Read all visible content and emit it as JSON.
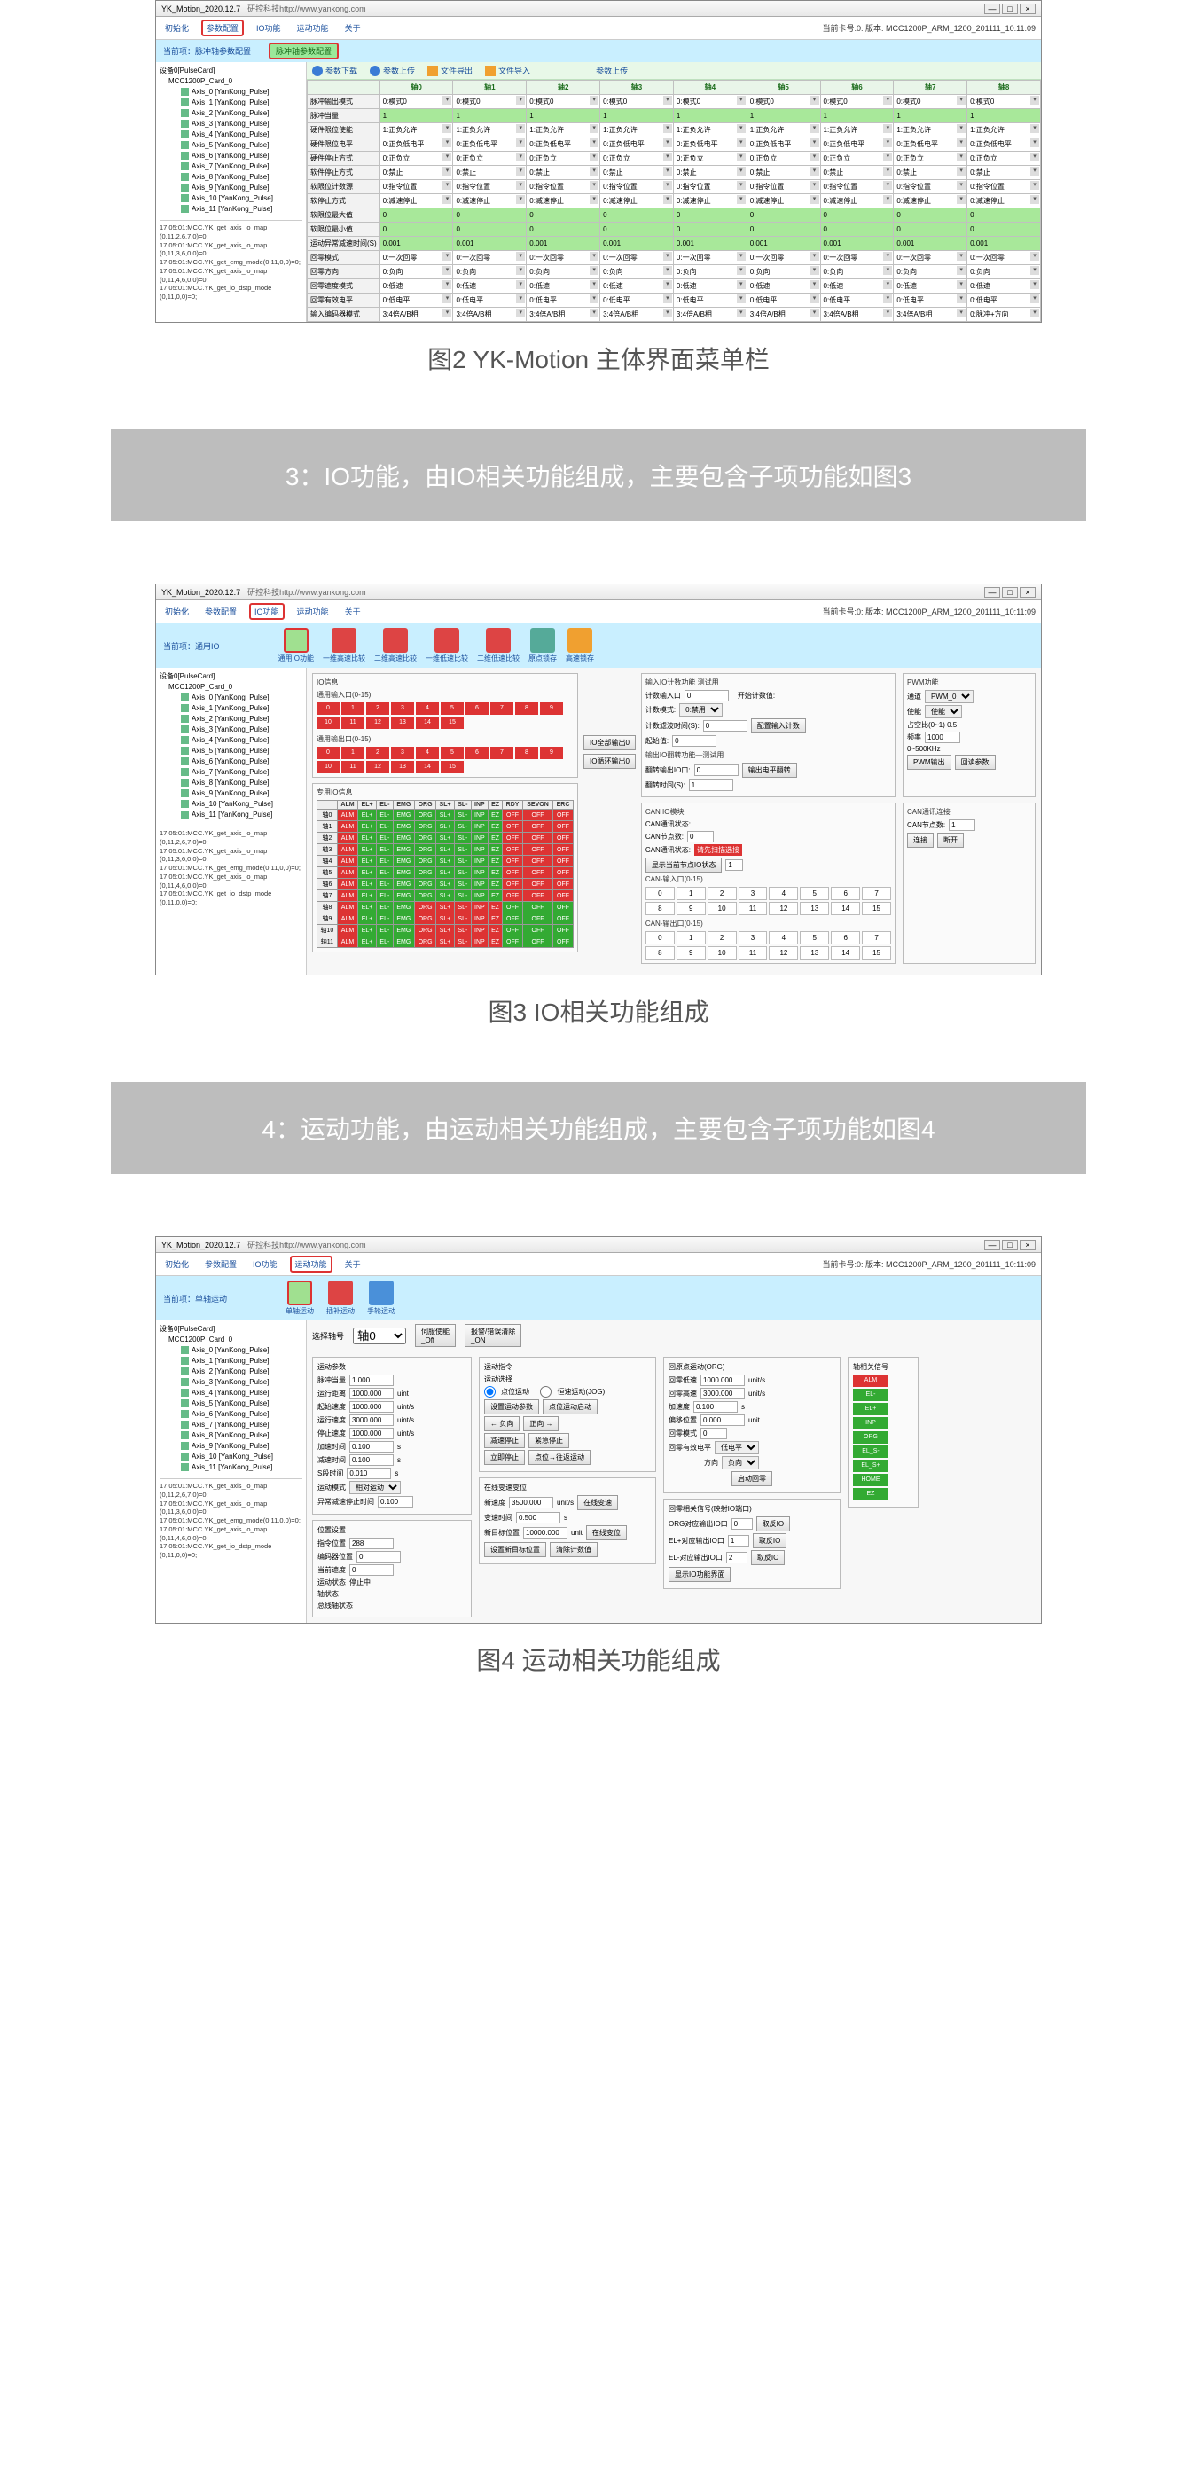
{
  "app_title": "YK_Motion_2020.12.7",
  "brand_text": "研控科技http://www.yankong.com",
  "card_info": "当前卡号:0: 版本: MCC1200P_ARM_1200_201111_10:11:09",
  "win_btns": {
    "min": "—",
    "max": "□",
    "close": "×"
  },
  "menu": {
    "init": "初始化",
    "param": "参数配置",
    "io": "IO功能",
    "motion": "运动功能",
    "about": "关于"
  },
  "tree": {
    "root": "设备0[PulseCard]",
    "card": "MCC1200P_Card_0",
    "axes": [
      "Axis_0  [YanKong_Pulse]",
      "Axis_1  [YanKong_Pulse]",
      "Axis_2  [YanKong_Pulse]",
      "Axis_3  [YanKong_Pulse]",
      "Axis_4  [YanKong_Pulse]",
      "Axis_5  [YanKong_Pulse]",
      "Axis_6  [YanKong_Pulse]",
      "Axis_7  [YanKong_Pulse]",
      "Axis_8  [YanKong_Pulse]",
      "Axis_9  [YanKong_Pulse]",
      "Axis_10 [YanKong_Pulse]",
      "Axis_11 [YanKong_Pulse]"
    ]
  },
  "log_lines": "17:05:01:MCC.YK_get_axis_io_map\n(0,11,2,6,7,0)=0;\n17:05:01:MCC.YK_get_axis_io_map\n(0,11,3,6,0,0)=0;\n17:05:01:MCC.YK_get_emg_mode(0,11,0,0)=0;\n17:05:01:MCC.YK_get_axis_io_map\n(0,11,4,6,0,0)=0;\n17:05:01:MCC.YK_get_io_dstp_mode\n(0,11,0,0)=0;",
  "fig2": {
    "current": "当前项：脉冲轴参数配置",
    "hilite": "脉冲轴参数配置",
    "toolbar": {
      "download": "参数下载",
      "upload": "参数上传",
      "export": "文件导出",
      "import": "文件导入",
      "param_upload": "参数上传"
    },
    "cols": [
      "轴0",
      "轴1",
      "轴2",
      "轴3",
      "轴4",
      "轴5",
      "轴6",
      "轴7",
      "轴8"
    ],
    "rows": [
      {
        "label": "脉冲输出模式",
        "green": false,
        "cells": [
          "0:模式0",
          "0:模式0",
          "0:模式0",
          "0:模式0",
          "0:模式0",
          "0:模式0",
          "0:模式0",
          "0:模式0",
          "0:模式0"
        ],
        "dd": true
      },
      {
        "label": "脉冲当量",
        "green": true,
        "cells": [
          "1",
          "1",
          "1",
          "1",
          "1",
          "1",
          "1",
          "1",
          "1"
        ],
        "dd": false
      },
      {
        "label": "硬件限位使能",
        "green": false,
        "cells": [
          "1:正负允许",
          "1:正负允许",
          "1:正负允许",
          "1:正负允许",
          "1:正负允许",
          "1:正负允许",
          "1:正负允许",
          "1:正负允许",
          "1:正负允许"
        ],
        "dd": true
      },
      {
        "label": "硬件限位电平",
        "green": false,
        "cells": [
          "0:正负低电平",
          "0:正负低电平",
          "0:正负低电平",
          "0:正负低电平",
          "0:正负低电平",
          "0:正负低电平",
          "0:正负低电平",
          "0:正负低电平",
          "0:正负低电平"
        ],
        "dd": true
      },
      {
        "label": "硬件停止方式",
        "green": false,
        "cells": [
          "0:正负立",
          "0:正负立",
          "0:正负立",
          "0:正负立",
          "0:正负立",
          "0:正负立",
          "0:正负立",
          "0:正负立",
          "0:正负立"
        ],
        "dd": true
      },
      {
        "label": "软件停止方式",
        "green": false,
        "cells": [
          "0:禁止",
          "0:禁止",
          "0:禁止",
          "0:禁止",
          "0:禁止",
          "0:禁止",
          "0:禁止",
          "0:禁止",
          "0:禁止"
        ],
        "dd": true
      },
      {
        "label": "软限位计数源",
        "green": false,
        "cells": [
          "0:指令位置",
          "0:指令位置",
          "0:指令位置",
          "0:指令位置",
          "0:指令位置",
          "0:指令位置",
          "0:指令位置",
          "0:指令位置",
          "0:指令位置"
        ],
        "dd": true
      },
      {
        "label": "软停止方式",
        "green": false,
        "cells": [
          "0:减速停止",
          "0:减速停止",
          "0:减速停止",
          "0:减速停止",
          "0:减速停止",
          "0:减速停止",
          "0:减速停止",
          "0:减速停止",
          "0:减速停止"
        ],
        "dd": true
      },
      {
        "label": "软限位最大值",
        "green": true,
        "cells": [
          "0",
          "0",
          "0",
          "0",
          "0",
          "0",
          "0",
          "0",
          "0"
        ],
        "dd": false
      },
      {
        "label": "软限位最小值",
        "green": true,
        "cells": [
          "0",
          "0",
          "0",
          "0",
          "0",
          "0",
          "0",
          "0",
          "0"
        ],
        "dd": false
      },
      {
        "label": "运动异常减速时间(S)",
        "green": true,
        "cells": [
          "0.001",
          "0.001",
          "0.001",
          "0.001",
          "0.001",
          "0.001",
          "0.001",
          "0.001",
          "0.001"
        ],
        "dd": false
      },
      {
        "label": "回零模式",
        "green": false,
        "cells": [
          "0:一次回零",
          "0:一次回零",
          "0:一次回零",
          "0:一次回零",
          "0:一次回零",
          "0:一次回零",
          "0:一次回零",
          "0:一次回零",
          "0:一次回零"
        ],
        "dd": true
      },
      {
        "label": "回零方向",
        "green": false,
        "cells": [
          "0:负向",
          "0:负向",
          "0:负向",
          "0:负向",
          "0:负向",
          "0:负向",
          "0:负向",
          "0:负向",
          "0:负向"
        ],
        "dd": true
      },
      {
        "label": "回零速度模式",
        "green": false,
        "cells": [
          "0:低速",
          "0:低速",
          "0:低速",
          "0:低速",
          "0:低速",
          "0:低速",
          "0:低速",
          "0:低速",
          "0:低速"
        ],
        "dd": true
      },
      {
        "label": "回零有效电平",
        "green": false,
        "cells": [
          "0:低电平",
          "0:低电平",
          "0:低电平",
          "0:低电平",
          "0:低电平",
          "0:低电平",
          "0:低电平",
          "0:低电平",
          "0:低电平"
        ],
        "dd": true
      },
      {
        "label": "输入编码器模式",
        "green": false,
        "cells": [
          "3:4倍A/B相",
          "3:4倍A/B相",
          "3:4倍A/B相",
          "3:4倍A/B相",
          "3:4倍A/B相",
          "3:4倍A/B相",
          "3:4倍A/B相",
          "3:4倍A/B相",
          "0:脉冲+方向"
        ],
        "dd": true
      }
    ]
  },
  "caption2": "图2 YK-Motion 主体界面菜单栏",
  "banner3": "3：IO功能，由IO相关功能组成，主要包含子项功能如图3",
  "fig3": {
    "current": "当前项：通用IO",
    "tabs": [
      "通用IO功能",
      "一维高速比较",
      "二维高速比较",
      "一维低速比较",
      "二维低速比较",
      "原点锁存",
      "高速锁存"
    ],
    "io_box_title": "IO信息",
    "in_title": "通用输入口(0-15)",
    "out_title": "通用输出口(0-15)",
    "ded_title": "专用IO信息",
    "io_nums_in": [
      "0",
      "1",
      "2",
      "3",
      "4",
      "5",
      "6",
      "7",
      "8",
      "9",
      "10",
      "11",
      "12",
      "13",
      "14",
      "15"
    ],
    "io_nums_out": [
      "0",
      "1",
      "2",
      "3",
      "4",
      "5",
      "6",
      "7",
      "8",
      "9",
      "10",
      "11",
      "12",
      "13",
      "14",
      "15"
    ],
    "btn_allout": "IO全部输出0",
    "btn_loopout": "IO循环输出0",
    "ded_cols": [
      "ALM",
      "EL+",
      "EL-",
      "EMG",
      "ORG",
      "SL+",
      "SL-",
      "INP",
      "EZ",
      "RDY",
      "SEVON",
      "ERC"
    ],
    "ded_rows": [
      "轴0",
      "轴1",
      "轴2",
      "轴3",
      "轴4",
      "轴5",
      "轴6",
      "轴7",
      "轴8",
      "轴9",
      "轴10",
      "轴11"
    ],
    "right": {
      "inio_title": "输入IO计数功能    测试用",
      "count_in": "计数输入口",
      "count_in_v": "0",
      "count_mode": "计数模式:",
      "count_mode_v": "0:禁用",
      "filter_time": "计数滤波时间(S):",
      "filter_time_v": "0",
      "btn_cfg_count": "配置输入计数",
      "start_v": "起始值:",
      "start_vv": "0",
      "out_flip": "输出IO翻转功能—测试用",
      "flip_out": "翻转输出IO口:",
      "flip_out_v": "0",
      "btn_flip": "输出电平翻转",
      "flip_time": "翻转时间(S):",
      "flip_time_v": "1",
      "can_box": "CAN IO模块",
      "can_ch": "CAN通讯状态:",
      "can_cnt": "CAN节点数:",
      "can_cnt_v": "0",
      "can_link": "CAN通讯状态:",
      "can_link_v": "请先扫描选接",
      "btn_scan": "显示当前节点IO状态",
      "btn_scan_v": "1",
      "can_in": "CAN-输入口(0-15)",
      "can_out": "CAN-输出口(0-15)",
      "can_link2": "CAN通讯连接",
      "btn_conn": "连接",
      "btn_disc": "断开",
      "pwm_box": "PWM功能",
      "pwm_ch": "通道",
      "pwm_ch_v": "PWM_0",
      "pwm_en": "使能",
      "pwm_en_v": "使能",
      "duty": "占空比(0~1) 0.5",
      "freq": "频率",
      "freq_v": "1000",
      "freq_u": "0~500KHz",
      "btn_pwm": "PWM输出",
      "btn_read": "回读参数",
      "btn_count_start": "开始计数值:"
    }
  },
  "caption3": "图3 IO相关功能组成",
  "banner4": "4：运动功能，由运动相关功能组成，主要包含子项功能如图4",
  "fig4": {
    "current": "当前项：单轴运动",
    "tabs": [
      "单轴运动",
      "插补运动",
      "手轮运动"
    ],
    "sel_axis": "选择轴号",
    "sel_axis_v": "轴0",
    "servo_enable": "伺服使能",
    "servo_off": "_Off",
    "alarm_clear": "报警/错误清除",
    "alarm_on": "_ON",
    "grp_param": "运动参数",
    "pulse_eq": "脉冲当量",
    "pulse_eq_v": "1.000",
    "run_dist": "运行距离",
    "run_dist_v": "1000.000",
    "u_uint": "uint",
    "start_spd": "起始速度",
    "start_spd_v": "1000.000",
    "u_us": "uint/s",
    "run_spd": "运行速度",
    "run_spd_v": "3000.000",
    "stop_spd": "停止速度",
    "stop_spd_v": "1000.000",
    "acc_time": "加速时间",
    "acc_time_v": "0.100",
    "u_s": "s",
    "dec_time": "减速时间",
    "dec_time_v": "0.100",
    "s_time": "S段时间",
    "s_time_v": "0.010",
    "mode": "运动模式",
    "mode_v": "相对运动",
    "abn_dec": "异常减速停止时间",
    "abn_dec_v": "0.100",
    "grp_pos": "位置设置",
    "cmd_pos": "指令位置",
    "cmd_pos_v": "288",
    "enc_pos": "编码器位置",
    "enc_pos_v": "0",
    "cur_spd": "当前速度",
    "cur_spd_v": "0",
    "mot_state": "运动状态",
    "mot_state_v": "停止中",
    "ax_state": "轴状态",
    "ax_total": "总线轴状态",
    "grp_cmd": "运动指令",
    "mot_sel": "运动选择",
    "rad_pt": "点位运动",
    "rad_jog": "恒速运动(JOG)",
    "btn_setp": "设置运动参数",
    "btn_jog": "点位运动启动",
    "btn_neg": "← 负向",
    "btn_pos": "正向 →",
    "btn_decstop": "减速停止",
    "btn_estop": "紧急停止",
    "btn_stopnow": "立即停止",
    "btn_ptprec": "点位→往返运动",
    "grp_online": "在线变速变位",
    "new_spd": "新速度",
    "new_spd_v": "3500.000",
    "u_us2": "unit/s",
    "btn_ovs": "在线变速",
    "ovs_time": "变速时间",
    "ovs_time_v": "0.500",
    "new_tgt": "新目标位置",
    "new_tgt_v": "10000.000",
    "u_unit": "unit",
    "btn_ovp": "在线变位",
    "btn_settgt": "设置新目标位置",
    "btn_clearcnt": "清除计数值",
    "grp_home": "回原点运动(ORG)",
    "home_low": "回零低速",
    "home_low_v": "1000.000",
    "u_us3": "unit/s",
    "home_high": "回零高速",
    "home_high_v": "3000.000",
    "home_acc": "加速度",
    "home_acc_v": "0.100",
    "home_off": "偏移位置",
    "home_off_v": "0.000",
    "u_unit2": "unit",
    "home_mode": "回零模式",
    "home_mode_v": "0",
    "home_ef": "回零有效电平",
    "home_ef_v": "低电平",
    "home_dir": "方向",
    "home_dir_v": "负向",
    "btn_starthome": "启动回零",
    "grp_homemap": "回零相关信号(映射IO端口)",
    "org_map": "ORG对应输出IO口",
    "org_map_v": "0",
    "btn_pick0": "取反IO",
    "elp_map": "EL+对应输出IO口",
    "elp_map_v": "1",
    "btn_pick1": "取反IO",
    "eln_map": "EL-对应输出IO口",
    "eln_map_v": "2",
    "btn_pick2": "取反IO",
    "btn_showio": "显示IO功能界面",
    "grp_sig": "轴相关信号",
    "sigs": [
      "ALM",
      "EL-",
      "EL+",
      "INP",
      "ORG",
      "EL_S-",
      "EL_S+",
      "HOME",
      "EZ"
    ]
  },
  "caption4": "图4 运动相关功能组成"
}
